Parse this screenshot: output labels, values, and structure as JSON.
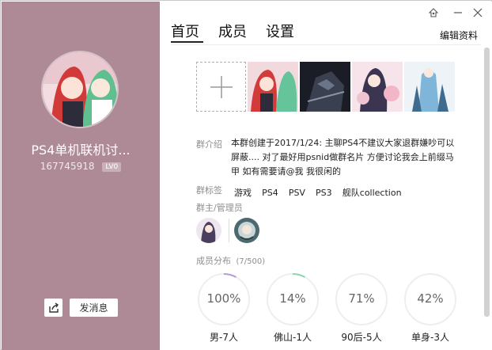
{
  "profile": {
    "group_name": "PS4单机联机讨...",
    "group_id": "167745918",
    "level": "LV0",
    "send_message_label": "发消息"
  },
  "tabs": [
    {
      "label": "首页",
      "active": true
    },
    {
      "label": "成员",
      "active": false
    },
    {
      "label": "设置",
      "active": false
    }
  ],
  "edit_label": "编辑资料",
  "intro": {
    "label": "群介绍",
    "text": "本群创建于2017/1/24:  主聊PS4不建议大家退群嫌吵可以屏蔽.... 对了最好用psnid做群名片 方便讨论我会上前缀马甲 如有需要请@我 我很闲的"
  },
  "tags": {
    "label": "群标签",
    "items": [
      "游戏",
      "PS4",
      "PSV",
      "PS3",
      "舰队collection"
    ]
  },
  "admins": {
    "label": "群主/管理员"
  },
  "members": {
    "label": "成员分布",
    "count": "(7/500)",
    "stats": [
      {
        "percent": "100%",
        "fraction": 1.0,
        "label": "男-7人",
        "color": "#b39ddb"
      },
      {
        "percent": "14%",
        "fraction": 0.14,
        "label": "佛山-1人",
        "color": "#8fd3b0"
      },
      {
        "percent": "71%",
        "fraction": 0.71,
        "label": "90后-5人",
        "color": "#eeeeee"
      },
      {
        "percent": "42%",
        "fraction": 0.42,
        "label": "单身-3人",
        "color": "#eeeeee"
      }
    ]
  },
  "colors": {
    "left_panel": "#ad8a95",
    "accent_text": "#111111",
    "muted": "#8e8e8e"
  },
  "icons": {
    "window": [
      "skin-icon",
      "minimize-icon",
      "close-icon"
    ],
    "share": "share-icon",
    "add_photo": "plus-icon"
  }
}
